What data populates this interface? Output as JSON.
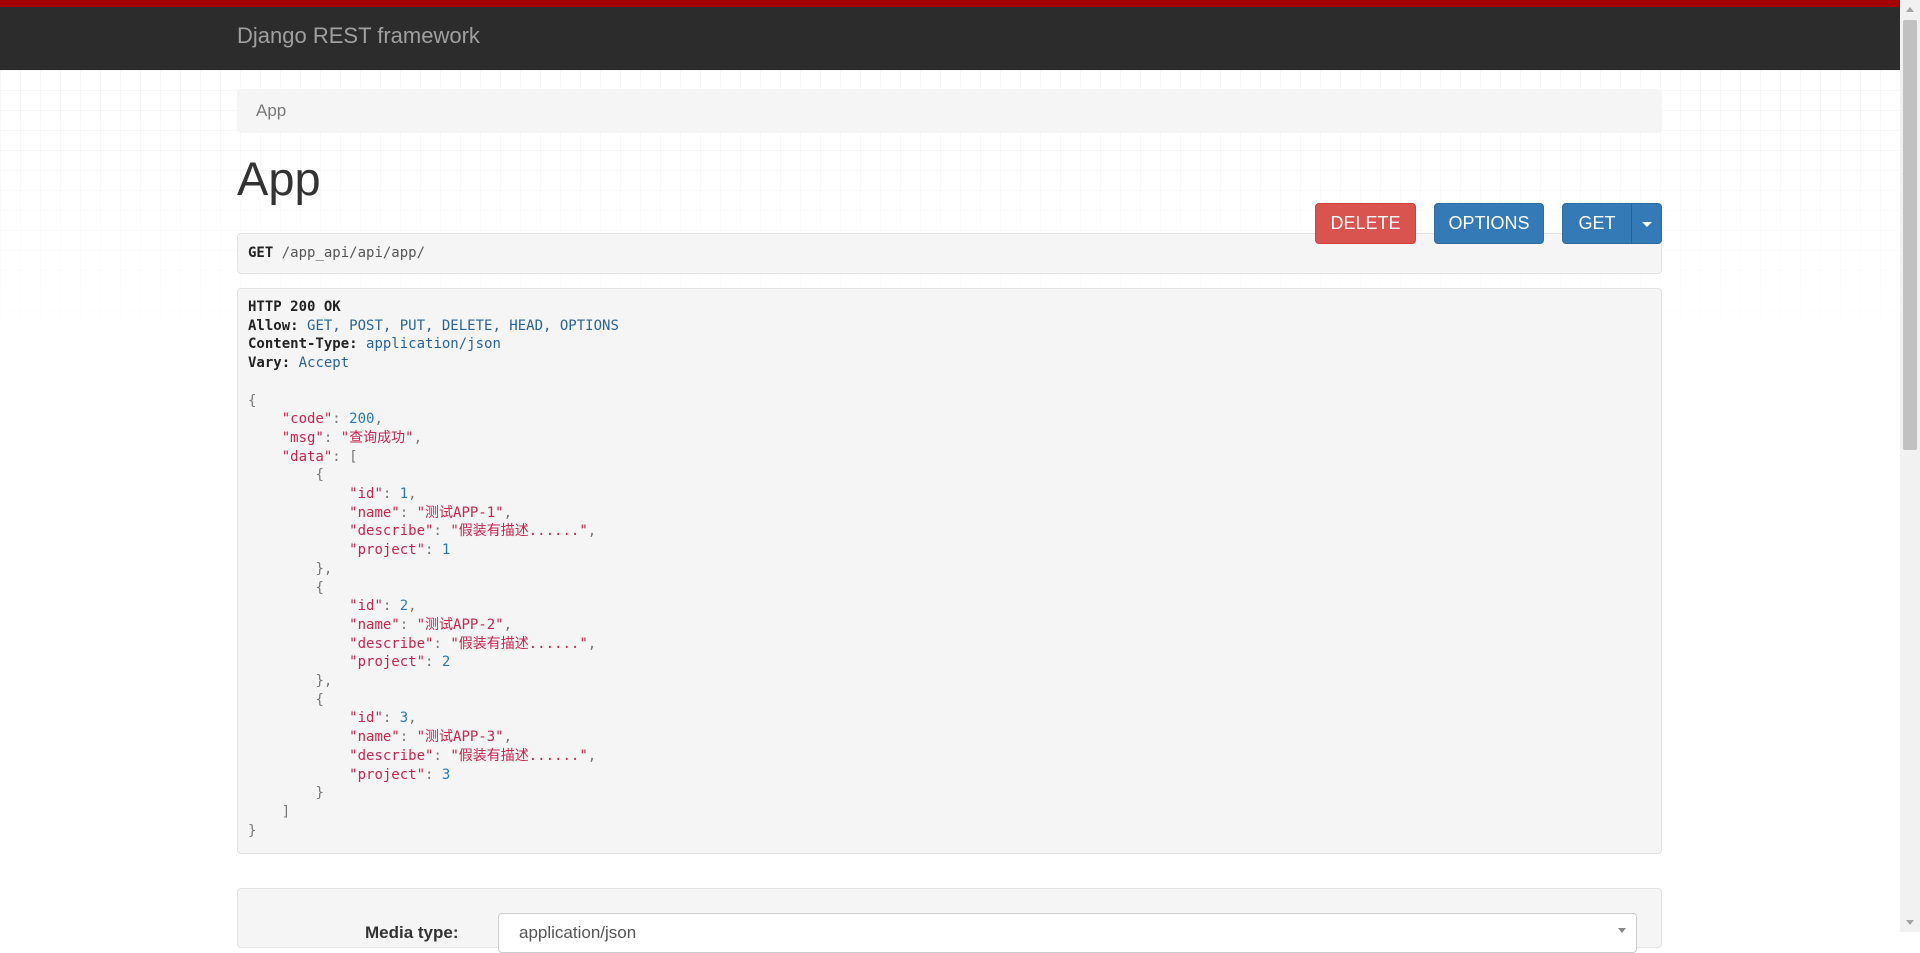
{
  "navbar": {
    "brand": "Django REST framework"
  },
  "breadcrumb": {
    "items": [
      "App"
    ]
  },
  "page": {
    "title": "App"
  },
  "buttons": {
    "delete": "DELETE",
    "options": "OPTIONS",
    "get": "GET"
  },
  "request": {
    "method": "GET",
    "path": "/app_api/api/app/"
  },
  "response": {
    "status": "HTTP 200 OK",
    "headers": [
      {
        "key": "Allow:",
        "value": "GET, POST, PUT, DELETE, HEAD, OPTIONS"
      },
      {
        "key": "Content-Type:",
        "value": "application/json"
      },
      {
        "key": "Vary:",
        "value": "Accept"
      }
    ],
    "body": {
      "code": 200,
      "msg": "查询成功",
      "data": [
        {
          "id": 1,
          "name": "测试APP-1",
          "describe": "假装有描述......",
          "project": 1
        },
        {
          "id": 2,
          "name": "测试APP-2",
          "describe": "假装有描述......",
          "project": 2
        },
        {
          "id": 3,
          "name": "测试APP-3",
          "describe": "假装有描述......",
          "project": 3
        }
      ]
    }
  },
  "form": {
    "media_type_label": "Media type:",
    "media_type_value": "application/json"
  },
  "colors": {
    "navbar_bg": "#2c2c2c",
    "navbar_accent": "#a30000",
    "danger": "#d9534f",
    "primary": "#337ab7",
    "json_key": "#c7254e",
    "json_number": "#2a7ab7"
  }
}
